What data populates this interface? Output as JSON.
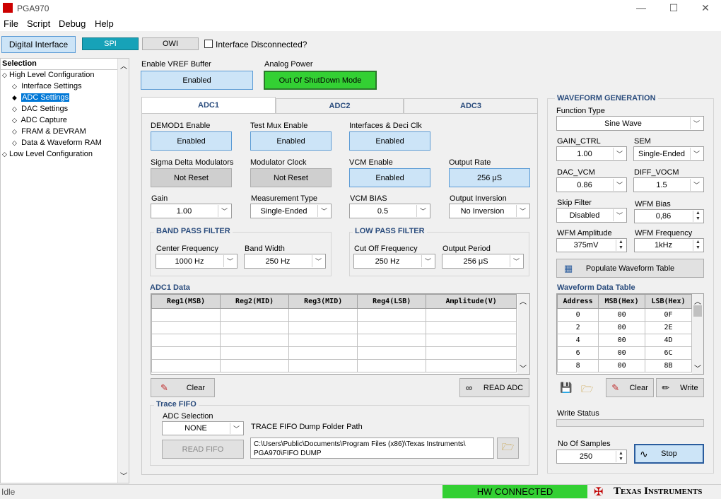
{
  "window": {
    "title": "PGA970",
    "minimize": "—",
    "maximize": "☐",
    "close": "✕"
  },
  "menu": [
    "File",
    "Script",
    "Debug",
    "Help"
  ],
  "toolbar": {
    "digital_interface": "Digital Interface",
    "spi": "SPI",
    "owi": "OWI",
    "interface_disconnected": "Interface Disconnected?"
  },
  "tree": {
    "header": "Selection",
    "items": [
      {
        "label": "High Level Configuration",
        "level": 0,
        "selected": false
      },
      {
        "label": "Interface Settings",
        "level": 1,
        "selected": false
      },
      {
        "label": "ADC Settings",
        "level": 1,
        "selected": true
      },
      {
        "label": "DAC Settings",
        "level": 1,
        "selected": false
      },
      {
        "label": "ADC Capture",
        "level": 1,
        "selected": false
      },
      {
        "label": "FRAM & DEVRAM",
        "level": 1,
        "selected": false
      },
      {
        "label": "Data & Waveform RAM",
        "level": 1,
        "selected": false
      },
      {
        "label": "Low Level Configuration",
        "level": 0,
        "selected": false
      }
    ]
  },
  "top": {
    "vref_label": "Enable VREF Buffer",
    "vref_value": "Enabled",
    "analog_label": "Analog Power",
    "analog_value": "Out Of ShutDown Mode"
  },
  "tabs": [
    "ADC1",
    "ADC2",
    "ADC3"
  ],
  "adc1": {
    "demod_label": "DEMOD1 Enable",
    "demod_value": "Enabled",
    "testmux_label": "Test Mux Enable",
    "testmux_value": "Enabled",
    "interfaces_label": "Interfaces & Deci Clk",
    "interfaces_value": "Enabled",
    "sdm_label": "Sigma Delta Modulators",
    "sdm_value": "Not Reset",
    "modclk_label": "Modulator Clock",
    "modclk_value": "Not Reset",
    "vcm_label": "VCM Enable",
    "vcm_value": "Enabled",
    "rate_label": "Output Rate",
    "rate_value": "256 μS",
    "gain_label": "Gain",
    "gain_value": "1.00",
    "meas_label": "Measurement Type",
    "meas_value": "Single-Ended",
    "vcmbias_label": "VCM BIAS",
    "vcmbias_value": "0.5",
    "inv_label": "Output Inversion",
    "inv_value": "No Inversion",
    "bpf_title": "BAND PASS FILTER",
    "cf_label": "Center Frequency",
    "cf_value": "1000 Hz",
    "bw_label": "Band Width",
    "bw_value": "250 Hz",
    "lpf_title": "LOW PASS FILTER",
    "co_label": "Cut Off Frequency",
    "co_value": "250 Hz",
    "op_label": "Output Period",
    "op_value": "256 μS",
    "data_title": "ADC1 Data",
    "columns": [
      "Reg1(MSB)",
      "Reg2(MID)",
      "Reg3(MID)",
      "Reg4(LSB)",
      "Amplitude(V)"
    ],
    "clear": "Clear",
    "read_adc": "READ ADC"
  },
  "trace": {
    "title": "Trace FIFO",
    "adc_sel_label": "ADC Selection",
    "adc_sel_value": "NONE",
    "path_label": "TRACE FIFO Dump Folder Path",
    "path_line1": "C:\\Users\\Public\\Documents\\Program Files (x86)\\Texas Instruments\\",
    "path_line2": "PGA970\\FIFO DUMP",
    "read_fifo": "READ FIFO"
  },
  "wave": {
    "title": "WAVEFORM GENERATION",
    "func_label": "Function Type",
    "func_value": "Sine Wave",
    "gain_label": "GAIN_CTRL",
    "gain_value": "1.00",
    "sem_label": "SEM",
    "sem_value": "Single-Ended",
    "dacvcm_label": "DAC_VCM",
    "dacvcm_value": "0.86",
    "diff_label": "DIFF_VOCM",
    "diff_value": "1.5",
    "skip_label": "Skip Filter",
    "skip_value": "Disabled",
    "bias_label": "WFM Bias",
    "bias_value": "0,86",
    "amp_label": "WFM Amplitude",
    "amp_value": "375mV",
    "freq_label": "WFM Frequency",
    "freq_value": "1kHz",
    "populate": "Populate Waveform Table",
    "table_title": "Waveform Data Table",
    "columns": [
      "Address",
      "MSB(Hex)",
      "LSB(Hex)"
    ],
    "rows": [
      [
        "0",
        "00",
        "0F"
      ],
      [
        "2",
        "00",
        "2E"
      ],
      [
        "4",
        "00",
        "4D"
      ],
      [
        "6",
        "00",
        "6C"
      ],
      [
        "8",
        "00",
        "8B"
      ]
    ],
    "clear": "Clear",
    "write": "Write",
    "write_status": "Write Status",
    "samples_label": "No Of Samples",
    "samples_value": "250",
    "stop": "Stop"
  },
  "status": {
    "left": "Idle",
    "hw": "HW CONNECTED",
    "brand": "Texas Instruments"
  },
  "colors": {
    "accent": "#cce4f7",
    "green": "#33d033",
    "spi": "#17a2b8",
    "brand": "#c00000"
  }
}
